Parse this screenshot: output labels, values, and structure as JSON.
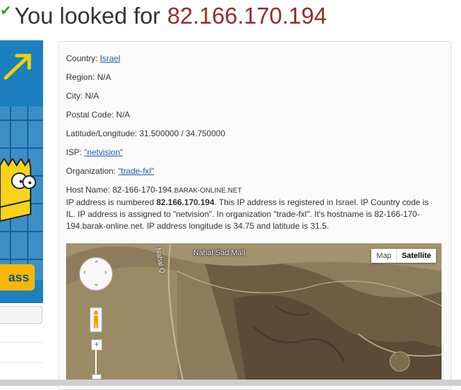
{
  "header": {
    "prefix": "You looked for",
    "ip": "82.166.170.194"
  },
  "ad": {
    "button_text": "ass"
  },
  "details": {
    "country_label": "Country:",
    "country_value": "Israel",
    "region": "Region: N/A",
    "city": "City: N/A",
    "postal": "Postal Code: N/A",
    "latlng": "Latitude/Longitude: 31.500000 / 34.750000",
    "isp_label": "ISP:",
    "isp_value": "\"netvision\"",
    "org_label": "Organization:",
    "org_value": "\"trade-fxl\"",
    "host_label": "Host Name:",
    "host_prefix": "82-166-170-194.",
    "host_suffix": "barak-online.net"
  },
  "description": {
    "part1": "IP address is numbered ",
    "ip_bold": "82.166.170.194",
    "part2": ". This IP address is registered in Israel. IP Country code is IL. IP address is assigned to \"netvision\". In organization \"trade-fxl\". It's hostname is 82-166-170-194.barak-online.net. IP address longitude is 34.75 and latitude is 31.5."
  },
  "map": {
    "type_map": "Map",
    "type_satellite": "Satellite",
    "place_label": "Nahal Sad Mall",
    "road_label": "Nahal Q",
    "zoom_in": "+"
  },
  "colors": {
    "ip_color": "#9a2a2a",
    "link_color": "#1a5fa8",
    "ad_blue": "#1b7fc0",
    "ad_yellow": "#f5b80a"
  }
}
